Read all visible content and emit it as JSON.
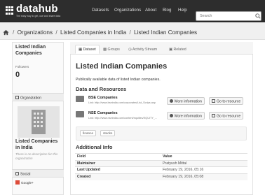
{
  "header": {
    "logo_text": "datahub",
    "logo_tagline": "The easy way to get, use and share data",
    "nav": [
      "Datasets",
      "Organizations",
      "About",
      "Blog",
      "Help"
    ],
    "search_placeholder": "Search"
  },
  "breadcrumb": {
    "items": [
      "Organizations",
      "Listed Companies in India",
      "Listed Indian Companies"
    ],
    "separator": "/"
  },
  "sidebar": {
    "title": "Listed Indian Companies",
    "followers_label": "Followers",
    "followers_count": "0",
    "organization_heading": "Organization",
    "organization_name": "Listed Companies in India",
    "organization_description": "There is no description for this organization",
    "social_heading": "Social",
    "social_items": [
      "Google+"
    ]
  },
  "tabs": [
    "Dataset",
    "Groups",
    "Activity Stream",
    "Related"
  ],
  "dataset": {
    "title": "Listed Indian Companies",
    "description": "Publically available data of listed Indian companies.",
    "resources_heading": "Data and Resources",
    "resources": [
      {
        "name": "BSE Companies",
        "link": "Link: http://www.bseindia.com/corporates/List_Scrips.asp"
      },
      {
        "name": "NSE Companies",
        "link": "Link: http://www.nseindia.com/content/equities/EQUITY_..."
      }
    ],
    "more_info_label": "More information",
    "go_to_resource_label": "Go to resource",
    "tags": [
      "finance",
      "stocks"
    ]
  },
  "additional_info": {
    "heading": "Additional Info",
    "columns": [
      "Field",
      "Value"
    ],
    "rows": [
      [
        "Maintainer",
        "Pratyush Mittal"
      ],
      [
        "Last Updated",
        "February 19, 2016, 05:16"
      ],
      [
        "Created",
        "February 19, 2016, 05:08"
      ]
    ]
  },
  "colors": {
    "header_bg": "#2d2d2d",
    "crumb_bg": "#f0f0f0",
    "google_red": "#dd4b39"
  }
}
